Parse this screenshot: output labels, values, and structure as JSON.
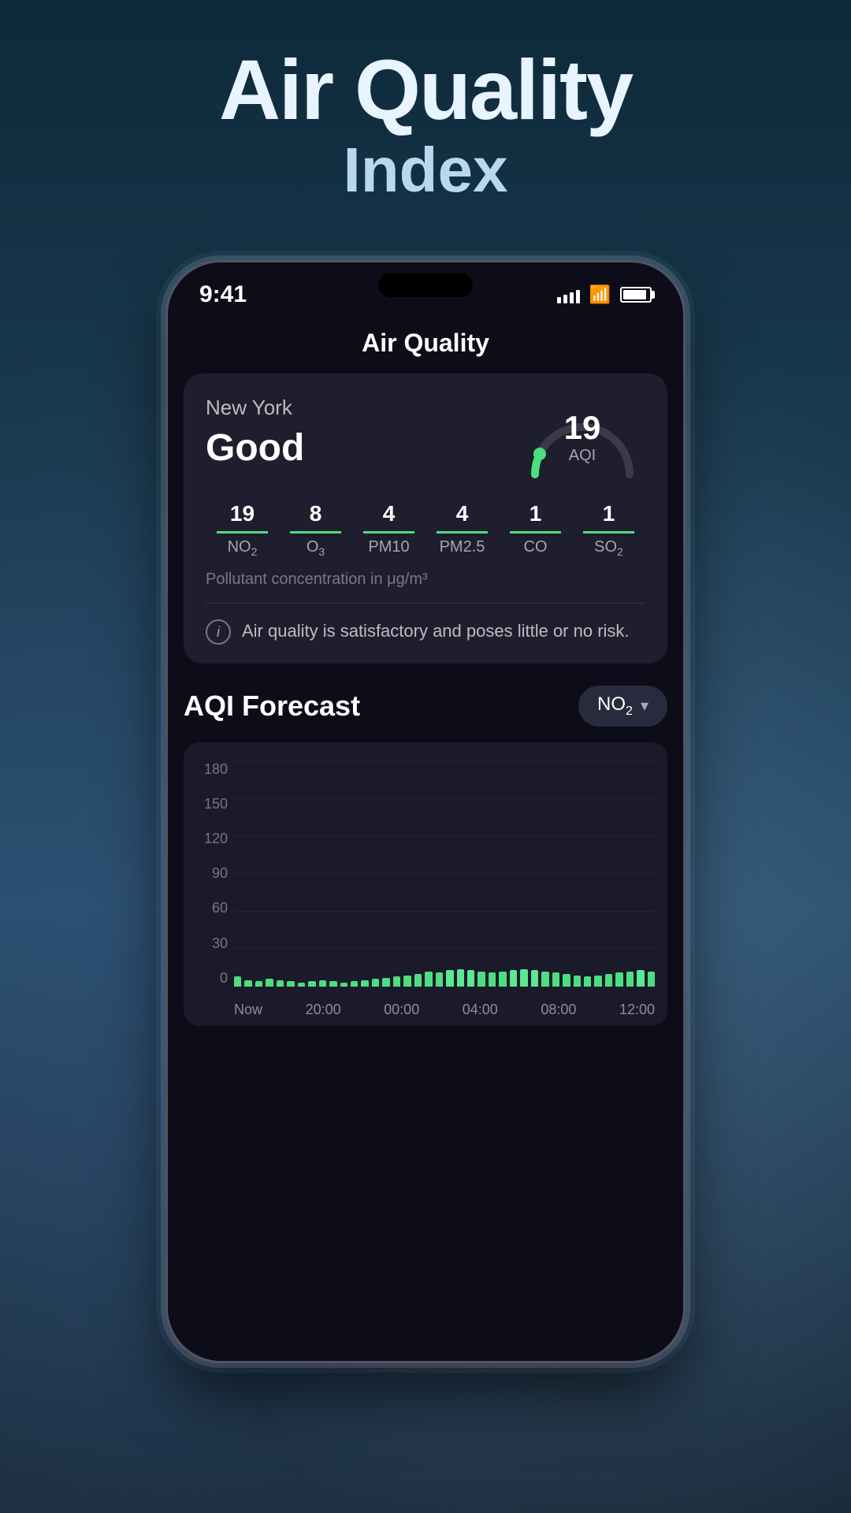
{
  "page": {
    "title_main": "Air Quality",
    "title_sub": "Index"
  },
  "status_bar": {
    "time": "9:41",
    "signal_bars": [
      6,
      9,
      12,
      15,
      18
    ],
    "battery_level": 90
  },
  "app": {
    "header_title": "Air Quality"
  },
  "aqi_card": {
    "location": "New York",
    "quality": "Good",
    "aqi_value": "19",
    "aqi_label": "AQI",
    "gauge_start": -200,
    "gauge_end": 20,
    "pollutants": [
      {
        "value": "19",
        "name": "NO",
        "sub": "2"
      },
      {
        "value": "8",
        "name": "O",
        "sub": "3"
      },
      {
        "value": "4",
        "name": "PM10",
        "sub": ""
      },
      {
        "value": "4",
        "name": "PM2.5",
        "sub": ""
      },
      {
        "value": "1",
        "name": "CO",
        "sub": ""
      },
      {
        "value": "1",
        "name": "SO",
        "sub": "2"
      }
    ],
    "concentration_note": "Pollutant concentration in μg/m³",
    "info_text": "Air quality is satisfactory and poses little or no risk."
  },
  "forecast": {
    "title": "AQI Forecast",
    "dropdown_label": "NO",
    "dropdown_sub": "2",
    "chart": {
      "y_labels": [
        "180",
        "150",
        "120",
        "90",
        "60",
        "30",
        "0"
      ],
      "x_labels": [
        "Now",
        "20:00",
        "00:00",
        "04:00",
        "08:00",
        "12:00"
      ],
      "bars": [
        8,
        5,
        4,
        6,
        5,
        4,
        3,
        4,
        5,
        4,
        3,
        4,
        5,
        6,
        7,
        8,
        9,
        10,
        12,
        11,
        13,
        14,
        13,
        12,
        11,
        12,
        13,
        14,
        13,
        12,
        11,
        10,
        9,
        8,
        9,
        10,
        11,
        12,
        13,
        12
      ]
    }
  }
}
